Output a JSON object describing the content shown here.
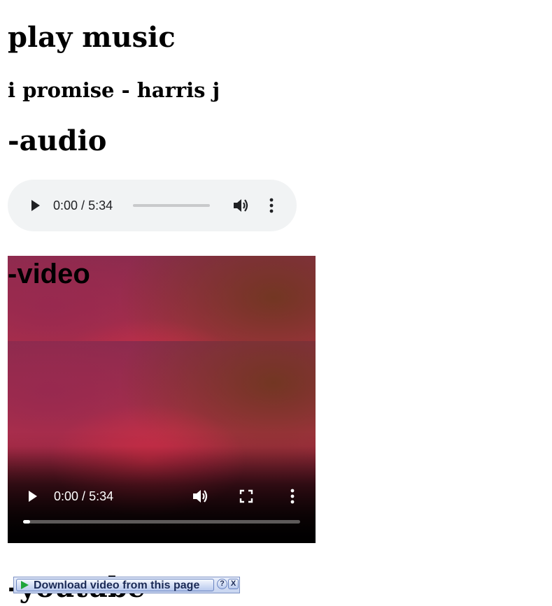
{
  "page": {
    "title": "play music",
    "subtitle": "i promise - harris j",
    "audio_heading": "-audio",
    "video_heading": "-video",
    "youtube_heading": "-youtube"
  },
  "audio_player": {
    "current_time": "0:00",
    "separator": " / ",
    "duration": "5:34",
    "progress": 0,
    "icons": [
      "play-icon",
      "volume-icon",
      "more-options-icon"
    ]
  },
  "video_player": {
    "current_time": "0:00",
    "separator": " / ",
    "duration": "5:34",
    "progress": 0.025,
    "icons": [
      "play-icon",
      "volume-icon",
      "fullscreen-icon",
      "more-options-icon"
    ]
  },
  "download_bar": {
    "label": "Download video from this page",
    "help_label": "?",
    "close_label": "X",
    "accent": "#1fa53a"
  }
}
